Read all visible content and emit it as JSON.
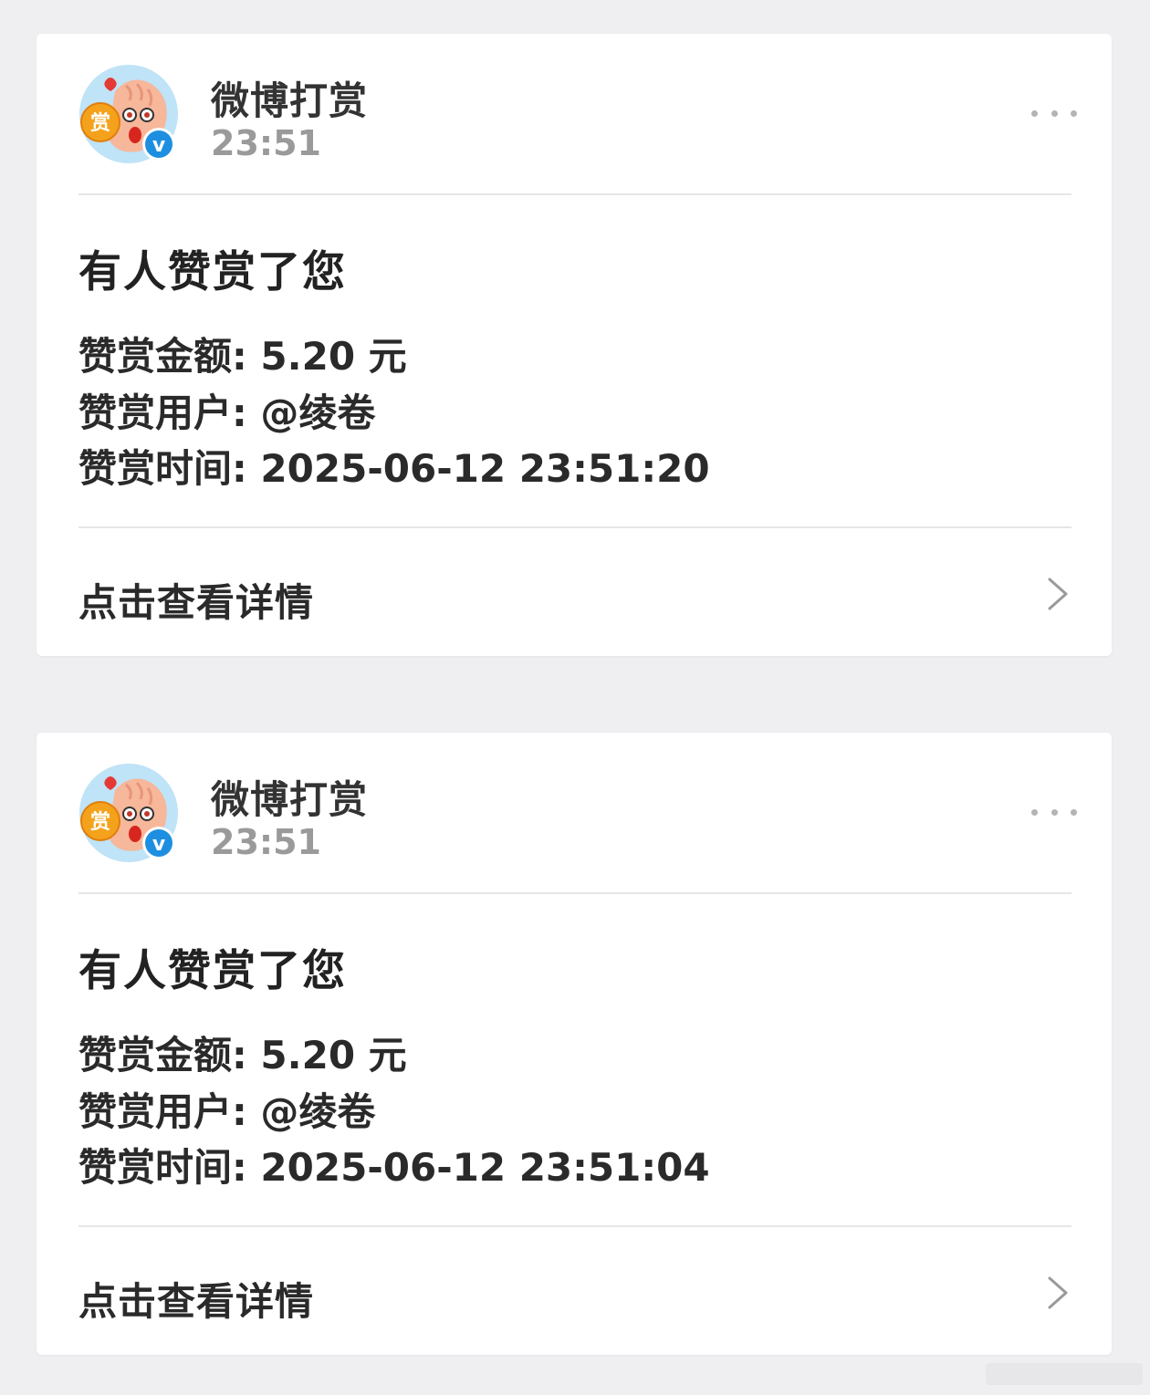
{
  "colors": {
    "page_bg": "#efeff1",
    "card_bg": "#ffffff",
    "title_text": "#222222",
    "muted_text": "#9a9a9a",
    "verified_badge": "#1e8fe0",
    "avatar_coin": "#f4a21c"
  },
  "cards": [
    {
      "sender": {
        "name": "微博打赏",
        "time": "23:51",
        "avatar_badge_text": "赏",
        "verified_mark": "v"
      },
      "title": "有人赞赏了您",
      "amount_line": "赞赏金额: 5.20 元",
      "user_line": "赞赏用户: @绫卷",
      "time_line": "赞赏时间: 2025-06-12 23:51:20",
      "detail_label": "点击查看详情"
    },
    {
      "sender": {
        "name": "微博打赏",
        "time": "23:51",
        "avatar_badge_text": "赏",
        "verified_mark": "v"
      },
      "title": "有人赞赏了您",
      "amount_line": "赞赏金额: 5.20 元",
      "user_line": "赞赏用户: @绫卷",
      "time_line": "赞赏时间: 2025-06-12 23:51:04",
      "detail_label": "点击查看详情"
    }
  ],
  "icons": {
    "more": "more-dots-icon",
    "chevron": "chevron-right-icon",
    "verified": "verified-badge-icon",
    "avatar": "reward-mascot-avatar"
  }
}
